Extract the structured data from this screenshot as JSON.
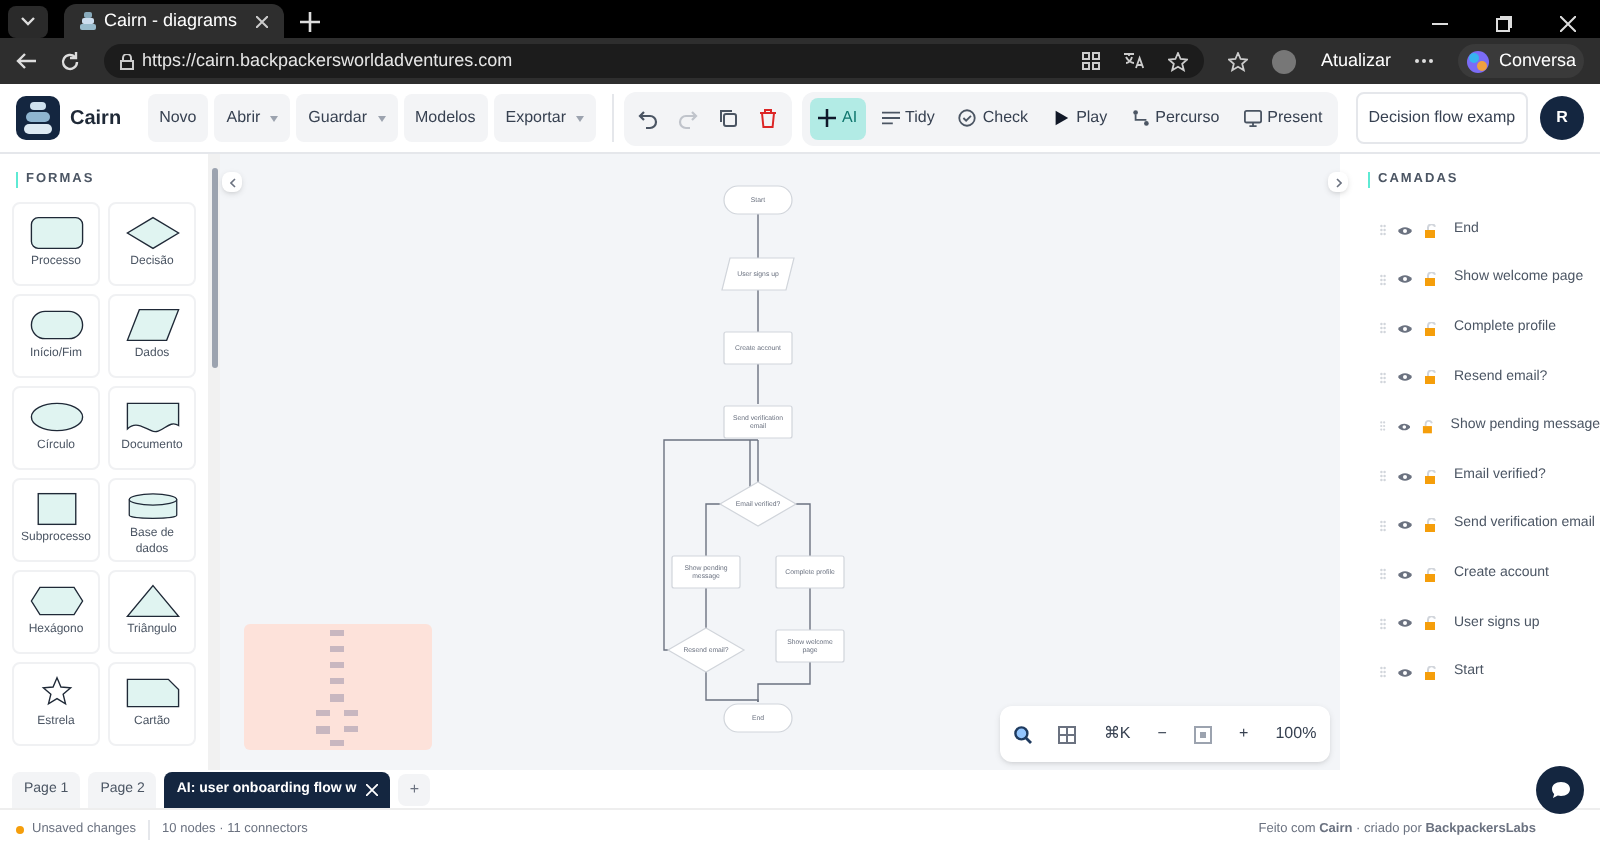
{
  "browser": {
    "tab_title": "Cairn - diagrams",
    "url": "https://cairn.backpackersworldadventures.com",
    "update_label": "Atualizar",
    "assistant_label": "Conversa"
  },
  "header": {
    "brand": "Cairn",
    "menus": [
      {
        "label": "Novo",
        "dropdown": false
      },
      {
        "label": "Abrir",
        "dropdown": true
      },
      {
        "label": "Guardar",
        "dropdown": true
      },
      {
        "label": "Modelos",
        "dropdown": false
      },
      {
        "label": "Exportar",
        "dropdown": true
      }
    ],
    "edit_actions": [
      {
        "kind": "undo",
        "disabled": false
      },
      {
        "kind": "redo",
        "disabled": true
      },
      {
        "kind": "copy",
        "disabled": false
      },
      {
        "kind": "delete",
        "disabled": false
      }
    ],
    "tools": [
      {
        "kind": "ai",
        "label": "AI",
        "selected": true
      },
      {
        "kind": "tidy",
        "label": "Tidy",
        "selected": false
      },
      {
        "kind": "check",
        "label": "Check",
        "selected": false
      },
      {
        "kind": "play",
        "label": "Play",
        "selected": false
      },
      {
        "kind": "route",
        "label": "Percurso",
        "selected": false
      },
      {
        "kind": "present",
        "label": "Present",
        "selected": false
      }
    ],
    "doc_title": "Decision flow examp",
    "avatar": "R"
  },
  "shapes_panel": {
    "title": "FORMAS",
    "shapes": [
      {
        "kind": "process",
        "label": "Processo"
      },
      {
        "kind": "decision",
        "label": "Decisão"
      },
      {
        "kind": "terminal",
        "label": "Início/Fim"
      },
      {
        "kind": "data",
        "label": "Dados"
      },
      {
        "kind": "circle",
        "label": "Círculo"
      },
      {
        "kind": "document",
        "label": "Documento"
      },
      {
        "kind": "subprocess",
        "label": "Subprocesso"
      },
      {
        "kind": "database",
        "label": "Base de dados"
      },
      {
        "kind": "hexagon",
        "label": "Hexágono"
      },
      {
        "kind": "triangle",
        "label": "Triângulo"
      },
      {
        "kind": "star",
        "label": "Estrela"
      },
      {
        "kind": "card",
        "label": "Cartão"
      }
    ]
  },
  "diagram": {
    "nodes": [
      {
        "kind": "terminal",
        "label": "Start"
      },
      {
        "kind": "data",
        "label": "User signs up"
      },
      {
        "kind": "process",
        "label": "Create account"
      },
      {
        "kind": "process",
        "label": "Send verification email"
      },
      {
        "kind": "decision",
        "label": "Email verified?"
      },
      {
        "kind": "process",
        "label": "Show pending message"
      },
      {
        "kind": "process",
        "label": "Complete profile"
      },
      {
        "kind": "decision",
        "label": "Resend email?"
      },
      {
        "kind": "process",
        "label": "Show welcome page"
      },
      {
        "kind": "terminal",
        "label": "End"
      }
    ]
  },
  "layers_panel": {
    "title": "CAMADAS",
    "layers": [
      "End",
      "Show welcome page",
      "Complete profile",
      "Resend email?",
      "Show pending message",
      "Email verified?",
      "Send verification email",
      "Create account",
      "User signs up",
      "Start"
    ]
  },
  "pages": [
    {
      "label": "Page 1",
      "selected": false
    },
    {
      "label": "Page 2",
      "selected": false
    },
    {
      "label": "AI: user onboarding flow w",
      "selected": true
    }
  ],
  "add_page": "+",
  "zoom_bar": {
    "shortcut": "⌘K",
    "minus": "−",
    "plus": "+",
    "zoom": "100%"
  },
  "status_bar": {
    "unsaved": "Unsaved changes",
    "counts": "10 nodes · 11 connectors",
    "credit": "Feito com **Cairn** · criado por **BackpackersLabs**"
  }
}
